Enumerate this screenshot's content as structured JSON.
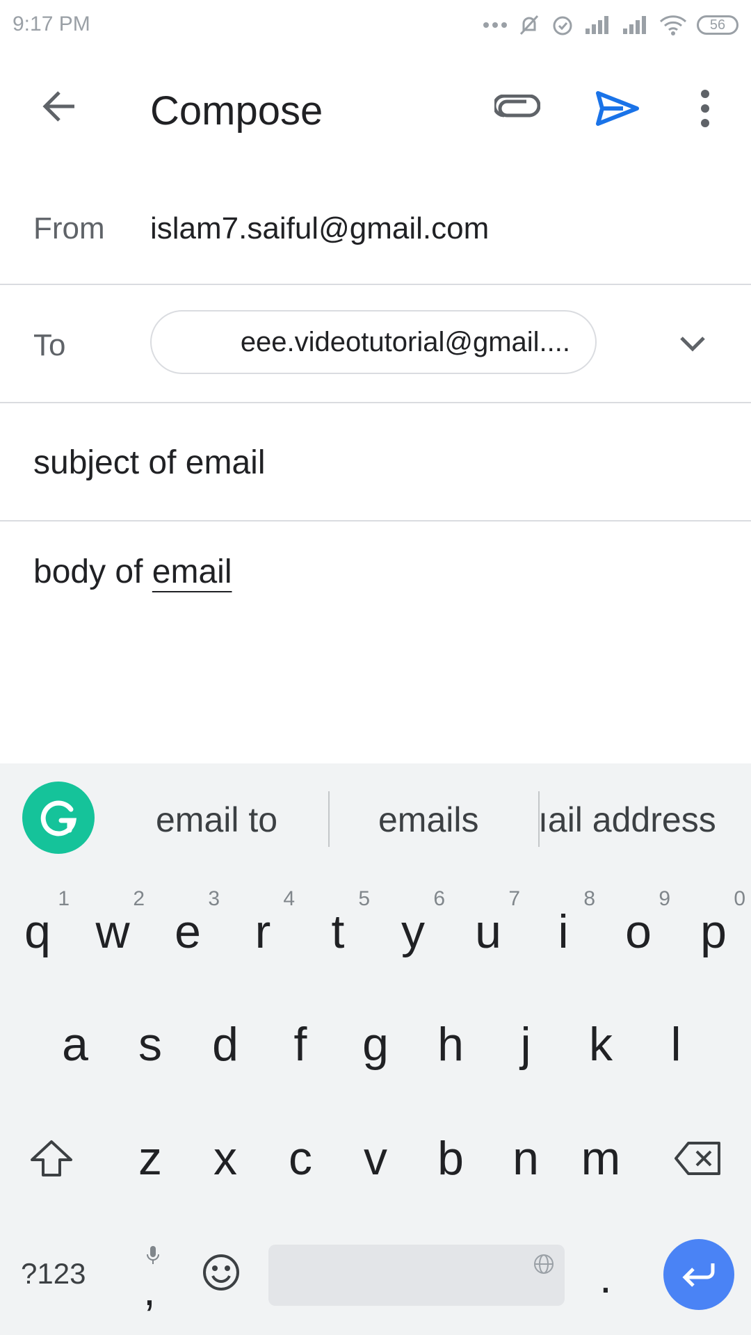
{
  "status_bar": {
    "time": "9:17 PM",
    "battery": "56"
  },
  "app_bar": {
    "title": "Compose"
  },
  "compose": {
    "from_label": "From",
    "from_value": "islam7.saiful@gmail.com",
    "to_label": "To",
    "to_chip": "eee.videotutorial@gmail....",
    "subject": "subject of email",
    "body_prefix": "body of ",
    "body_underlined": "email"
  },
  "keyboard": {
    "suggestions": [
      "email to",
      "emails",
      "ıail address"
    ],
    "row1": [
      {
        "k": "q",
        "h": "1"
      },
      {
        "k": "w",
        "h": "2"
      },
      {
        "k": "e",
        "h": "3"
      },
      {
        "k": "r",
        "h": "4"
      },
      {
        "k": "t",
        "h": "5"
      },
      {
        "k": "y",
        "h": "6"
      },
      {
        "k": "u",
        "h": "7"
      },
      {
        "k": "i",
        "h": "8"
      },
      {
        "k": "o",
        "h": "9"
      },
      {
        "k": "p",
        "h": "0"
      }
    ],
    "row2": [
      "a",
      "s",
      "d",
      "f",
      "g",
      "h",
      "j",
      "k",
      "l"
    ],
    "row3": [
      "z",
      "x",
      "c",
      "v",
      "b",
      "n",
      "m"
    ],
    "symbols_label": "?123",
    "comma": ",",
    "period": "."
  },
  "colors": {
    "send_blue": "#1a73e8",
    "grammarly_green": "#15c39a",
    "enter_blue": "#4a83f5",
    "keyboard_bg": "#f1f3f4"
  },
  "icons": [
    "back-arrow-icon",
    "paperclip-icon",
    "send-icon",
    "more-vert-icon",
    "chevron-down-icon",
    "grammarly-icon",
    "shift-icon",
    "backspace-icon",
    "mic-icon",
    "emoji-icon",
    "globe-icon",
    "enter-icon"
  ]
}
